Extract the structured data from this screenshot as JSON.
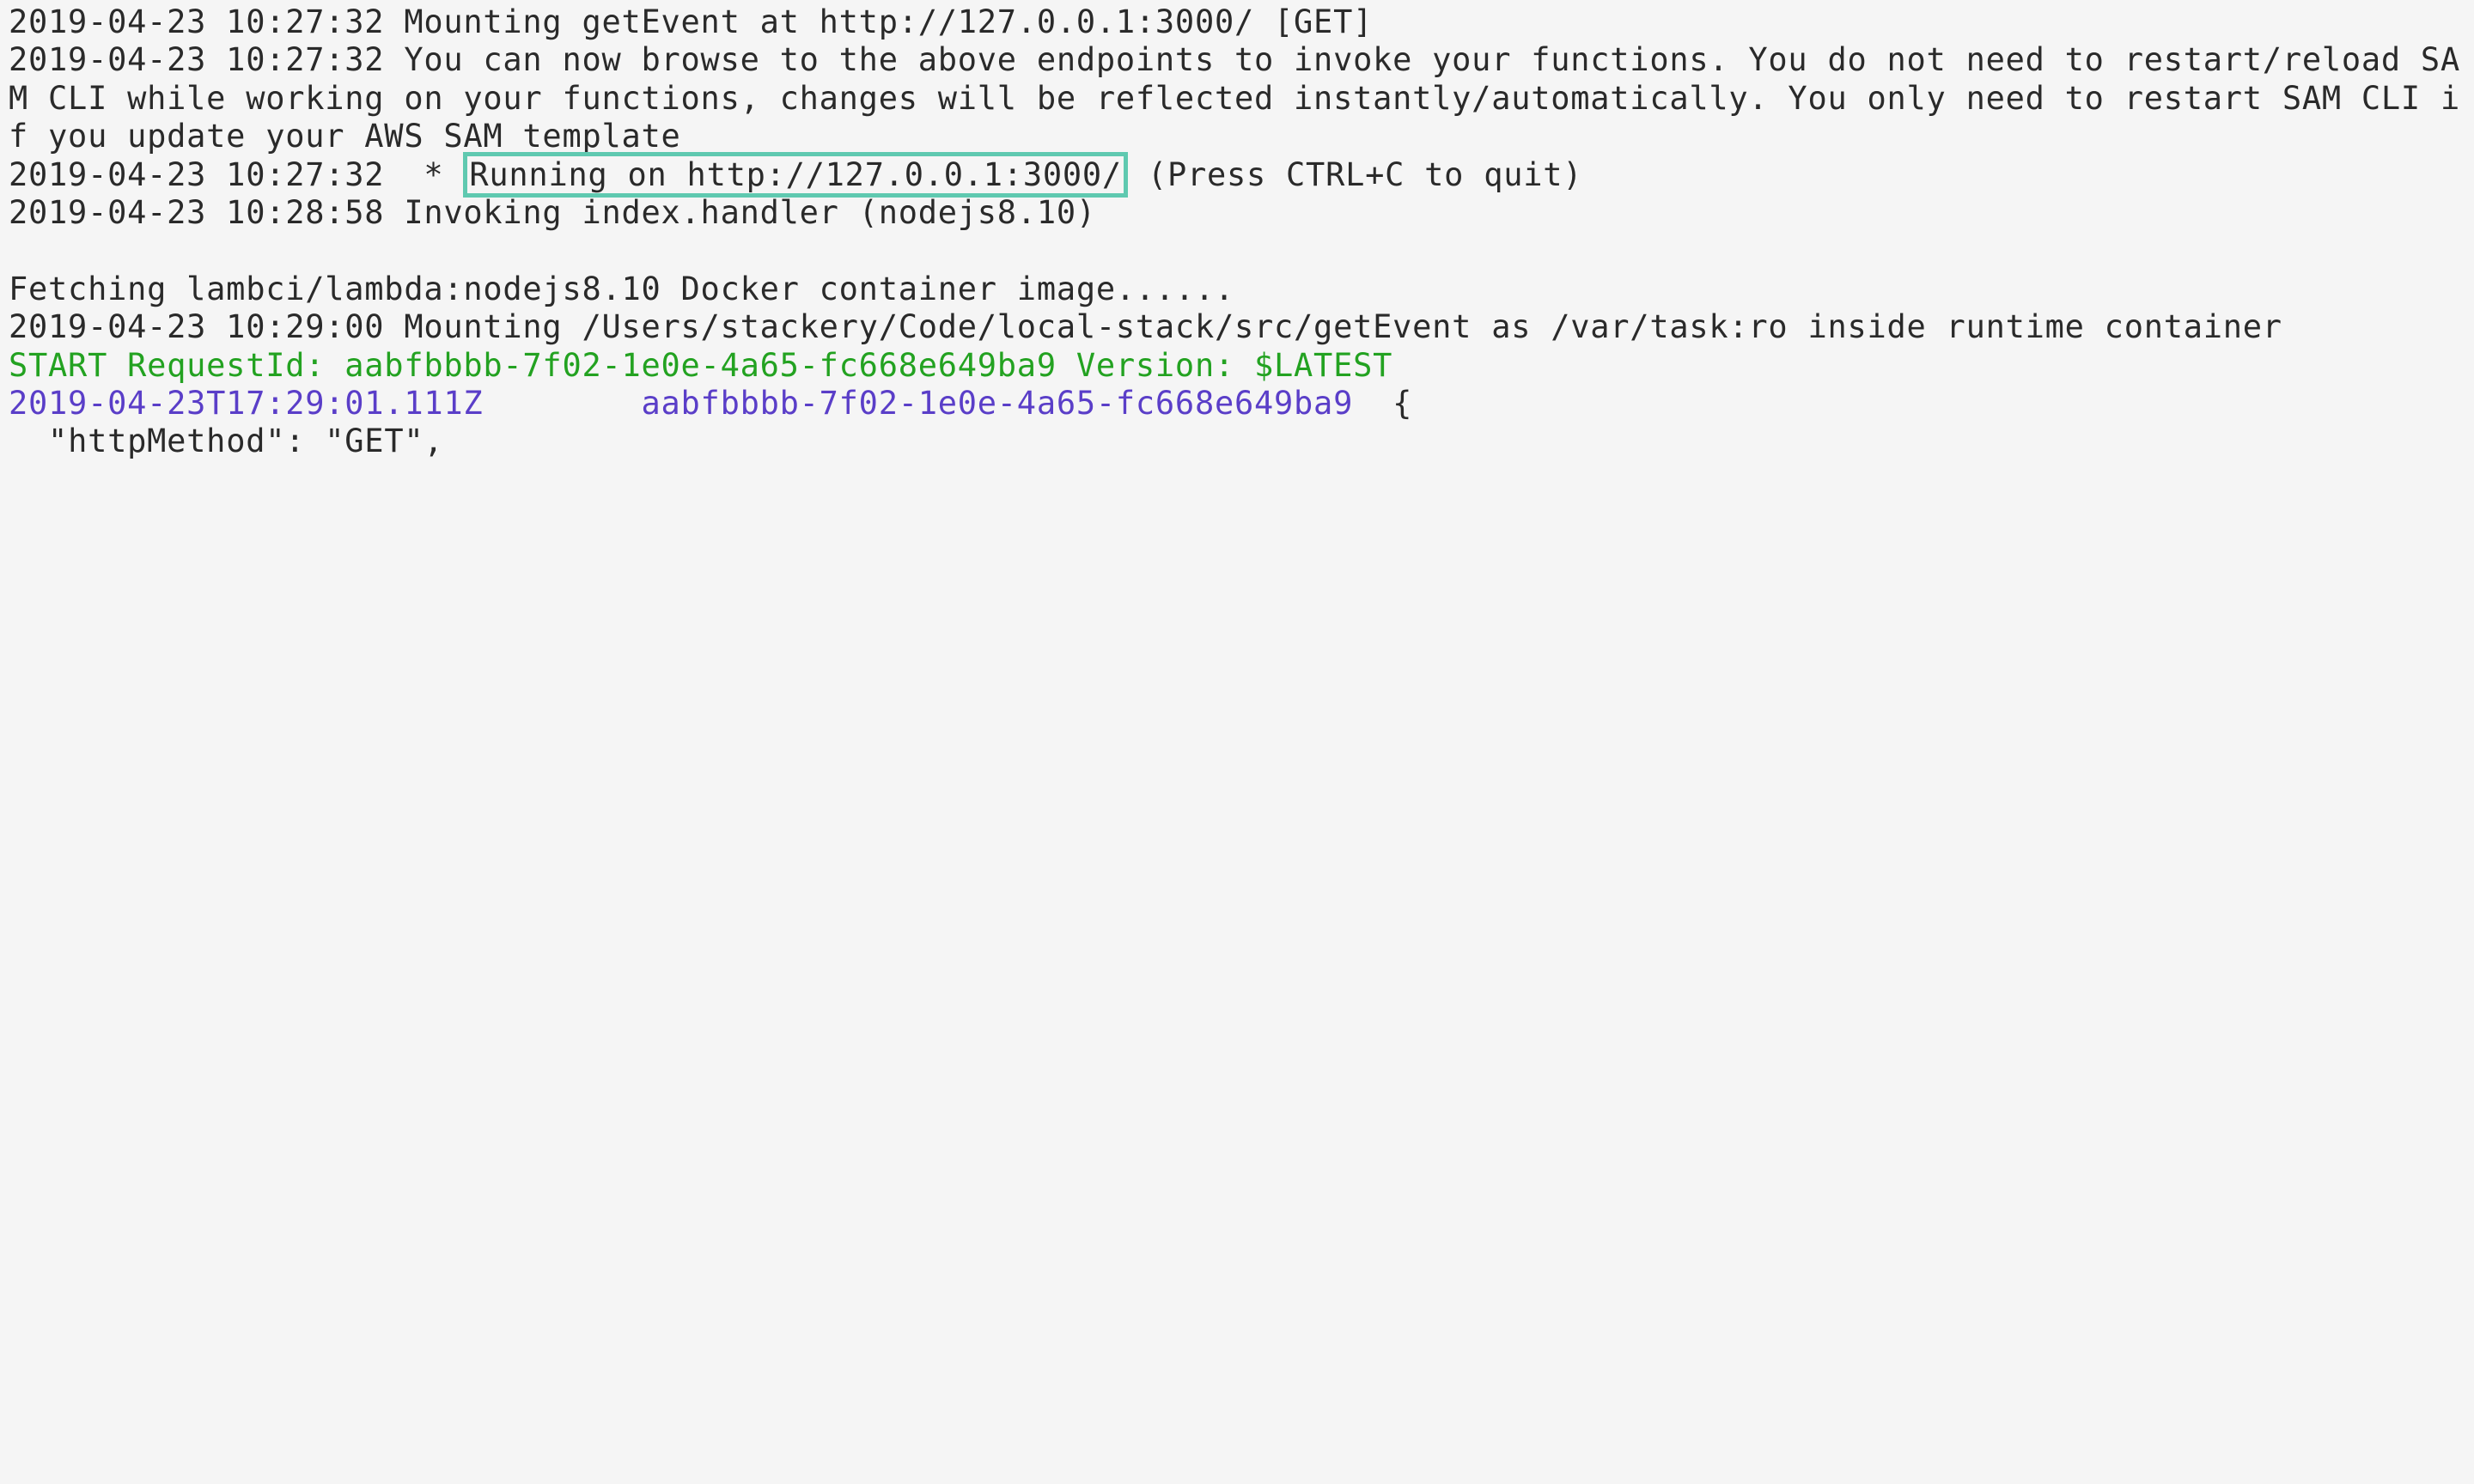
{
  "log": {
    "line1": "2019-04-23 10:27:32 Mounting getEvent at http://127.0.0.1:3000/ [GET]",
    "line2": "2019-04-23 10:27:32 You can now browse to the above endpoints to invoke your functions. You do not need to restart/reload SAM CLI while working on your functions, changes will be reflected instantly/automatically. You only need to restart SAM CLI if you update your AWS SAM template",
    "line3_prefix": "2019-04-23 10:27:32  * ",
    "line3_highlight": "Running on http://127.0.0.1:3000/",
    "line3_suffix": " (Press CTRL+C to quit)",
    "line4": "2019-04-23 10:28:58 Invoking index.handler (nodejs8.10)",
    "blank": "",
    "line5": "Fetching lambci/lambda:nodejs8.10 Docker container image......",
    "line6": "2019-04-23 10:29:00 Mounting /Users/stackery/Code/local-stack/src/getEvent as /var/task:ro inside runtime container",
    "line7_green": "START RequestId: aabfbbbb-7f02-1e0e-4a65-fc668e649ba9 Version: $LATEST",
    "line8_purple": "2019-04-23T17:29:01.111Z        aabfbbbb-7f02-1e0e-4a65-fc668e649ba9",
    "line8_suffix": "  {",
    "line9": "  \"httpMethod\": \"GET\","
  }
}
